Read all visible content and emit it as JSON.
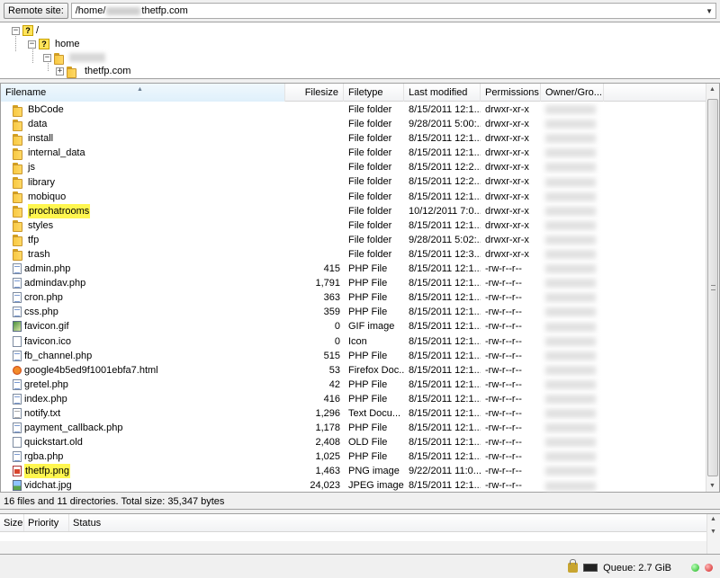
{
  "remote_site": {
    "label": "Remote site:",
    "path_prefix": "/home/",
    "path_suffix": "thetfp.com"
  },
  "tree": [
    {
      "label": "/",
      "icon": "unknown-folder-icon"
    },
    {
      "label": "home",
      "icon": "unknown-folder-icon"
    },
    {
      "label": "",
      "icon": "folder-icon"
    },
    {
      "label": "thetfp.com",
      "icon": "folder-icon"
    }
  ],
  "columns": {
    "filename": "Filename",
    "filesize": "Filesize",
    "filetype": "Filetype",
    "last_modified": "Last modified",
    "permissions": "Permissions",
    "owner": "Owner/Gro..."
  },
  "files": [
    {
      "name": "BbCode",
      "size": "",
      "type": "File folder",
      "modified": "8/15/2011 12:1...",
      "perms": "drwxr-xr-x",
      "icon": "folder",
      "highlight": false
    },
    {
      "name": "data",
      "size": "",
      "type": "File folder",
      "modified": "9/28/2011 5:00:...",
      "perms": "drwxr-xr-x",
      "icon": "folder",
      "highlight": false
    },
    {
      "name": "install",
      "size": "",
      "type": "File folder",
      "modified": "8/15/2011 12:1...",
      "perms": "drwxr-xr-x",
      "icon": "folder",
      "highlight": false
    },
    {
      "name": "internal_data",
      "size": "",
      "type": "File folder",
      "modified": "8/15/2011 12:1...",
      "perms": "drwxr-xr-x",
      "icon": "folder",
      "highlight": false
    },
    {
      "name": "js",
      "size": "",
      "type": "File folder",
      "modified": "8/15/2011 12:2...",
      "perms": "drwxr-xr-x",
      "icon": "folder",
      "highlight": false
    },
    {
      "name": "library",
      "size": "",
      "type": "File folder",
      "modified": "8/15/2011 12:2...",
      "perms": "drwxr-xr-x",
      "icon": "folder",
      "highlight": false
    },
    {
      "name": "mobiquo",
      "size": "",
      "type": "File folder",
      "modified": "8/15/2011 12:1...",
      "perms": "drwxr-xr-x",
      "icon": "folder",
      "highlight": false
    },
    {
      "name": "prochatrooms",
      "size": "",
      "type": "File folder",
      "modified": "10/12/2011 7:0...",
      "perms": "drwxr-xr-x",
      "icon": "folder",
      "highlight": true
    },
    {
      "name": "styles",
      "size": "",
      "type": "File folder",
      "modified": "8/15/2011 12:1...",
      "perms": "drwxr-xr-x",
      "icon": "folder",
      "highlight": false
    },
    {
      "name": "tfp",
      "size": "",
      "type": "File folder",
      "modified": "9/28/2011 5:02:...",
      "perms": "drwxr-xr-x",
      "icon": "folder",
      "highlight": false
    },
    {
      "name": "trash",
      "size": "",
      "type": "File folder",
      "modified": "8/15/2011 12:3...",
      "perms": "drwxr-xr-x",
      "icon": "folder",
      "highlight": false
    },
    {
      "name": "admin.php",
      "size": "415",
      "type": "PHP File",
      "modified": "8/15/2011 12:1...",
      "perms": "-rw-r--r--",
      "icon": "php",
      "highlight": false
    },
    {
      "name": "admindav.php",
      "size": "1,791",
      "type": "PHP File",
      "modified": "8/15/2011 12:1...",
      "perms": "-rw-r--r--",
      "icon": "php",
      "highlight": false
    },
    {
      "name": "cron.php",
      "size": "363",
      "type": "PHP File",
      "modified": "8/15/2011 12:1...",
      "perms": "-rw-r--r--",
      "icon": "php",
      "highlight": false
    },
    {
      "name": "css.php",
      "size": "359",
      "type": "PHP File",
      "modified": "8/15/2011 12:1...",
      "perms": "-rw-r--r--",
      "icon": "php",
      "highlight": false
    },
    {
      "name": "favicon.gif",
      "size": "0",
      "type": "GIF image",
      "modified": "8/15/2011 12:1...",
      "perms": "-rw-r--r--",
      "icon": "gif",
      "highlight": false
    },
    {
      "name": "favicon.ico",
      "size": "0",
      "type": "Icon",
      "modified": "8/15/2011 12:1...",
      "perms": "-rw-r--r--",
      "icon": "blank",
      "highlight": false
    },
    {
      "name": "fb_channel.php",
      "size": "515",
      "type": "PHP File",
      "modified": "8/15/2011 12:1...",
      "perms": "-rw-r--r--",
      "icon": "php",
      "highlight": false
    },
    {
      "name": "google4b5ed9f1001ebfa7.html",
      "size": "53",
      "type": "Firefox Doc...",
      "modified": "8/15/2011 12:1...",
      "perms": "-rw-r--r--",
      "icon": "ff",
      "highlight": false
    },
    {
      "name": "gretel.php",
      "size": "42",
      "type": "PHP File",
      "modified": "8/15/2011 12:1...",
      "perms": "-rw-r--r--",
      "icon": "php",
      "highlight": false
    },
    {
      "name": "index.php",
      "size": "416",
      "type": "PHP File",
      "modified": "8/15/2011 12:1...",
      "perms": "-rw-r--r--",
      "icon": "php",
      "highlight": false
    },
    {
      "name": "notify.txt",
      "size": "1,296",
      "type": "Text Docu...",
      "modified": "8/15/2011 12:1...",
      "perms": "-rw-r--r--",
      "icon": "txt",
      "highlight": false
    },
    {
      "name": "payment_callback.php",
      "size": "1,178",
      "type": "PHP File",
      "modified": "8/15/2011 12:1...",
      "perms": "-rw-r--r--",
      "icon": "php",
      "highlight": false
    },
    {
      "name": "quickstart.old",
      "size": "2,408",
      "type": "OLD File",
      "modified": "8/15/2011 12:1...",
      "perms": "-rw-r--r--",
      "icon": "blank",
      "highlight": false
    },
    {
      "name": "rgba.php",
      "size": "1,025",
      "type": "PHP File",
      "modified": "8/15/2011 12:1...",
      "perms": "-rw-r--r--",
      "icon": "php",
      "highlight": false
    },
    {
      "name": "thetfp.png",
      "size": "1,463",
      "type": "PNG image",
      "modified": "9/22/2011 11:0...",
      "perms": "-rw-r--r--",
      "icon": "png",
      "highlight": true
    },
    {
      "name": "vidchat.jpg",
      "size": "24,023",
      "type": "JPEG image",
      "modified": "8/15/2011 12:1...",
      "perms": "-rw-r--r--",
      "icon": "img",
      "highlight": false
    }
  ],
  "status_text": "16 files and 11 directories. Total size: 35,347 bytes",
  "queue_columns": [
    "Size",
    "Priority",
    "Status"
  ],
  "bottom": {
    "queue_label": "Queue: 2.7 GiB"
  },
  "colors": {
    "highlight": "#fff64f",
    "status_green": "#1fb31f",
    "status_red": "#d01f1f"
  }
}
